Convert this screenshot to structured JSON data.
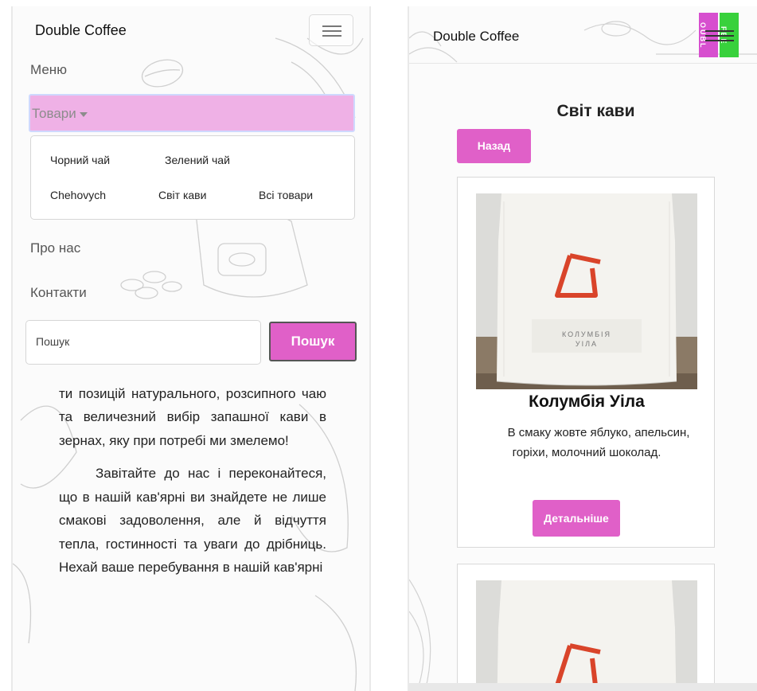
{
  "left": {
    "brand": "Double Coffee",
    "nav": {
      "menu": "Меню",
      "products": "Товари",
      "about": "Про нас",
      "contacts": "Контакти"
    },
    "dropdown": [
      "Чорний чай",
      "Зелений чай",
      "Chehovych",
      "Світ кави",
      "Всі товари"
    ],
    "search": {
      "placeholder": "Пошук",
      "button": "Пошук"
    },
    "intro": {
      "p1": "чаю. У нас ви зможете знайти більше 50-ти позицій натурального, розсипного чаю та величезний вибір запашної кави в зернах, яку при потребі ми змелемо!",
      "p2": "Завітайте до нас і переконайтеся, що в нашій кав'ярні ви знайдете не лише смакові задоволення, але й відчуття тепла, гостинності та уваги до дрібниць. Нехай ваше перебування в нашій кав'ярні"
    }
  },
  "right": {
    "brand": "Double Coffee",
    "logo": {
      "left_letters": "OUBL",
      "right_letters": "FEE"
    },
    "page_title": "Світ кави",
    "back_button": "Назад",
    "product": {
      "package_label_1": "КОЛУМБІЯ",
      "package_label_2": "УІЛА",
      "name": "Колумбія Уіла",
      "description": "В смаку жовте яблуко, апельсин, горіхи, молочний шоколад.",
      "button": "Детальніше"
    }
  },
  "colors": {
    "accent": "#e060c8",
    "nav_highlight": "#efb1e6",
    "logo_pink": "#d74fcf",
    "logo_green": "#38d13c",
    "package_mark": "#d9442a"
  }
}
